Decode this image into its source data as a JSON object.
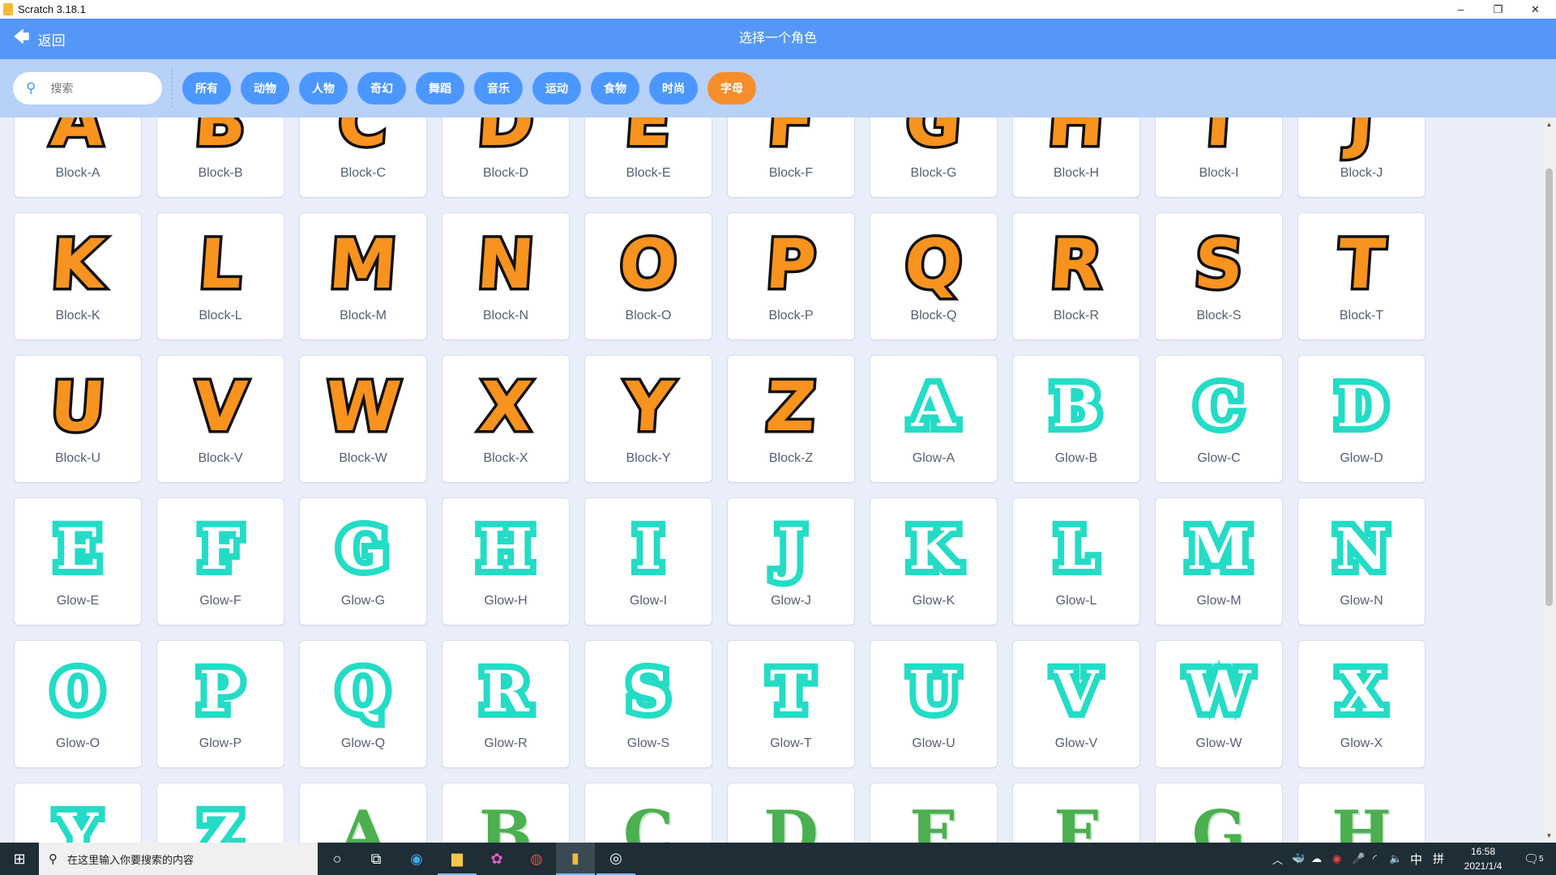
{
  "window": {
    "title": "Scratch 3.18.1",
    "minimize": "–",
    "restore": "❐",
    "close": "✕"
  },
  "header": {
    "back_label": "返回",
    "title": "选择一个角色"
  },
  "search": {
    "placeholder": "搜索"
  },
  "filters": [
    {
      "label": "所有",
      "active": false
    },
    {
      "label": "动物",
      "active": false
    },
    {
      "label": "人物",
      "active": false
    },
    {
      "label": "奇幻",
      "active": false
    },
    {
      "label": "舞蹈",
      "active": false
    },
    {
      "label": "音乐",
      "active": false
    },
    {
      "label": "运动",
      "active": false
    },
    {
      "label": "食物",
      "active": false
    },
    {
      "label": "时尚",
      "active": false
    },
    {
      "label": "字母",
      "active": true
    }
  ],
  "colors": {
    "header": "#5597f7",
    "filter_bar": "#b7d1f9",
    "tag": "#4c97ff",
    "tag_active": "#f58e2b",
    "block_fill": "#f7931e",
    "glow": "#24dcc6",
    "story": "#4caf50"
  },
  "sprites": [
    {
      "letter": "A",
      "style": "block",
      "label": "Block-A"
    },
    {
      "letter": "B",
      "style": "block",
      "label": "Block-B"
    },
    {
      "letter": "C",
      "style": "block",
      "label": "Block-C"
    },
    {
      "letter": "D",
      "style": "block",
      "label": "Block-D"
    },
    {
      "letter": "E",
      "style": "block",
      "label": "Block-E"
    },
    {
      "letter": "F",
      "style": "block",
      "label": "Block-F"
    },
    {
      "letter": "G",
      "style": "block",
      "label": "Block-G"
    },
    {
      "letter": "H",
      "style": "block",
      "label": "Block-H"
    },
    {
      "letter": "I",
      "style": "block",
      "label": "Block-I"
    },
    {
      "letter": "J",
      "style": "block",
      "label": "Block-J"
    },
    {
      "letter": "K",
      "style": "block",
      "label": "Block-K"
    },
    {
      "letter": "L",
      "style": "block",
      "label": "Block-L"
    },
    {
      "letter": "M",
      "style": "block",
      "label": "Block-M"
    },
    {
      "letter": "N",
      "style": "block",
      "label": "Block-N"
    },
    {
      "letter": "O",
      "style": "block",
      "label": "Block-O"
    },
    {
      "letter": "P",
      "style": "block",
      "label": "Block-P"
    },
    {
      "letter": "Q",
      "style": "block",
      "label": "Block-Q"
    },
    {
      "letter": "R",
      "style": "block",
      "label": "Block-R"
    },
    {
      "letter": "S",
      "style": "block",
      "label": "Block-S"
    },
    {
      "letter": "T",
      "style": "block",
      "label": "Block-T"
    },
    {
      "letter": "U",
      "style": "block",
      "label": "Block-U"
    },
    {
      "letter": "V",
      "style": "block",
      "label": "Block-V"
    },
    {
      "letter": "W",
      "style": "block",
      "label": "Block-W"
    },
    {
      "letter": "X",
      "style": "block",
      "label": "Block-X"
    },
    {
      "letter": "Y",
      "style": "block",
      "label": "Block-Y"
    },
    {
      "letter": "Z",
      "style": "block",
      "label": "Block-Z"
    },
    {
      "letter": "A",
      "style": "glow",
      "label": "Glow-A"
    },
    {
      "letter": "B",
      "style": "glow",
      "label": "Glow-B"
    },
    {
      "letter": "C",
      "style": "glow",
      "label": "Glow-C"
    },
    {
      "letter": "D",
      "style": "glow",
      "label": "Glow-D"
    },
    {
      "letter": "E",
      "style": "glow",
      "label": "Glow-E"
    },
    {
      "letter": "F",
      "style": "glow",
      "label": "Glow-F"
    },
    {
      "letter": "G",
      "style": "glow",
      "label": "Glow-G"
    },
    {
      "letter": "H",
      "style": "glow",
      "label": "Glow-H"
    },
    {
      "letter": "I",
      "style": "glow",
      "label": "Glow-I"
    },
    {
      "letter": "J",
      "style": "glow",
      "label": "Glow-J"
    },
    {
      "letter": "K",
      "style": "glow",
      "label": "Glow-K"
    },
    {
      "letter": "L",
      "style": "glow",
      "label": "Glow-L"
    },
    {
      "letter": "M",
      "style": "glow",
      "label": "Glow-M"
    },
    {
      "letter": "N",
      "style": "glow",
      "label": "Glow-N"
    },
    {
      "letter": "O",
      "style": "glow",
      "label": "Glow-O"
    },
    {
      "letter": "P",
      "style": "glow",
      "label": "Glow-P"
    },
    {
      "letter": "Q",
      "style": "glow",
      "label": "Glow-Q"
    },
    {
      "letter": "R",
      "style": "glow",
      "label": "Glow-R"
    },
    {
      "letter": "S",
      "style": "glow",
      "label": "Glow-S"
    },
    {
      "letter": "T",
      "style": "glow",
      "label": "Glow-T"
    },
    {
      "letter": "U",
      "style": "glow",
      "label": "Glow-U"
    },
    {
      "letter": "V",
      "style": "glow",
      "label": "Glow-V"
    },
    {
      "letter": "W",
      "style": "glow",
      "label": "Glow-W"
    },
    {
      "letter": "X",
      "style": "glow",
      "label": "Glow-X"
    },
    {
      "letter": "Y",
      "style": "glow"
    },
    {
      "letter": "Z",
      "style": "glow"
    },
    {
      "letter": "A",
      "style": "story"
    },
    {
      "letter": "B",
      "style": "story"
    },
    {
      "letter": "C",
      "style": "story"
    },
    {
      "letter": "D",
      "style": "story"
    },
    {
      "letter": "E",
      "style": "story"
    },
    {
      "letter": "F",
      "style": "story"
    },
    {
      "letter": "G",
      "style": "story"
    },
    {
      "letter": "H",
      "style": "story"
    }
  ],
  "taskbar": {
    "search_placeholder": "在这里输入你要搜索的内容",
    "ime_lang": "中",
    "ime_mode": "拼",
    "time": "16:58",
    "date": "2021/1/4",
    "notifications": "5"
  }
}
